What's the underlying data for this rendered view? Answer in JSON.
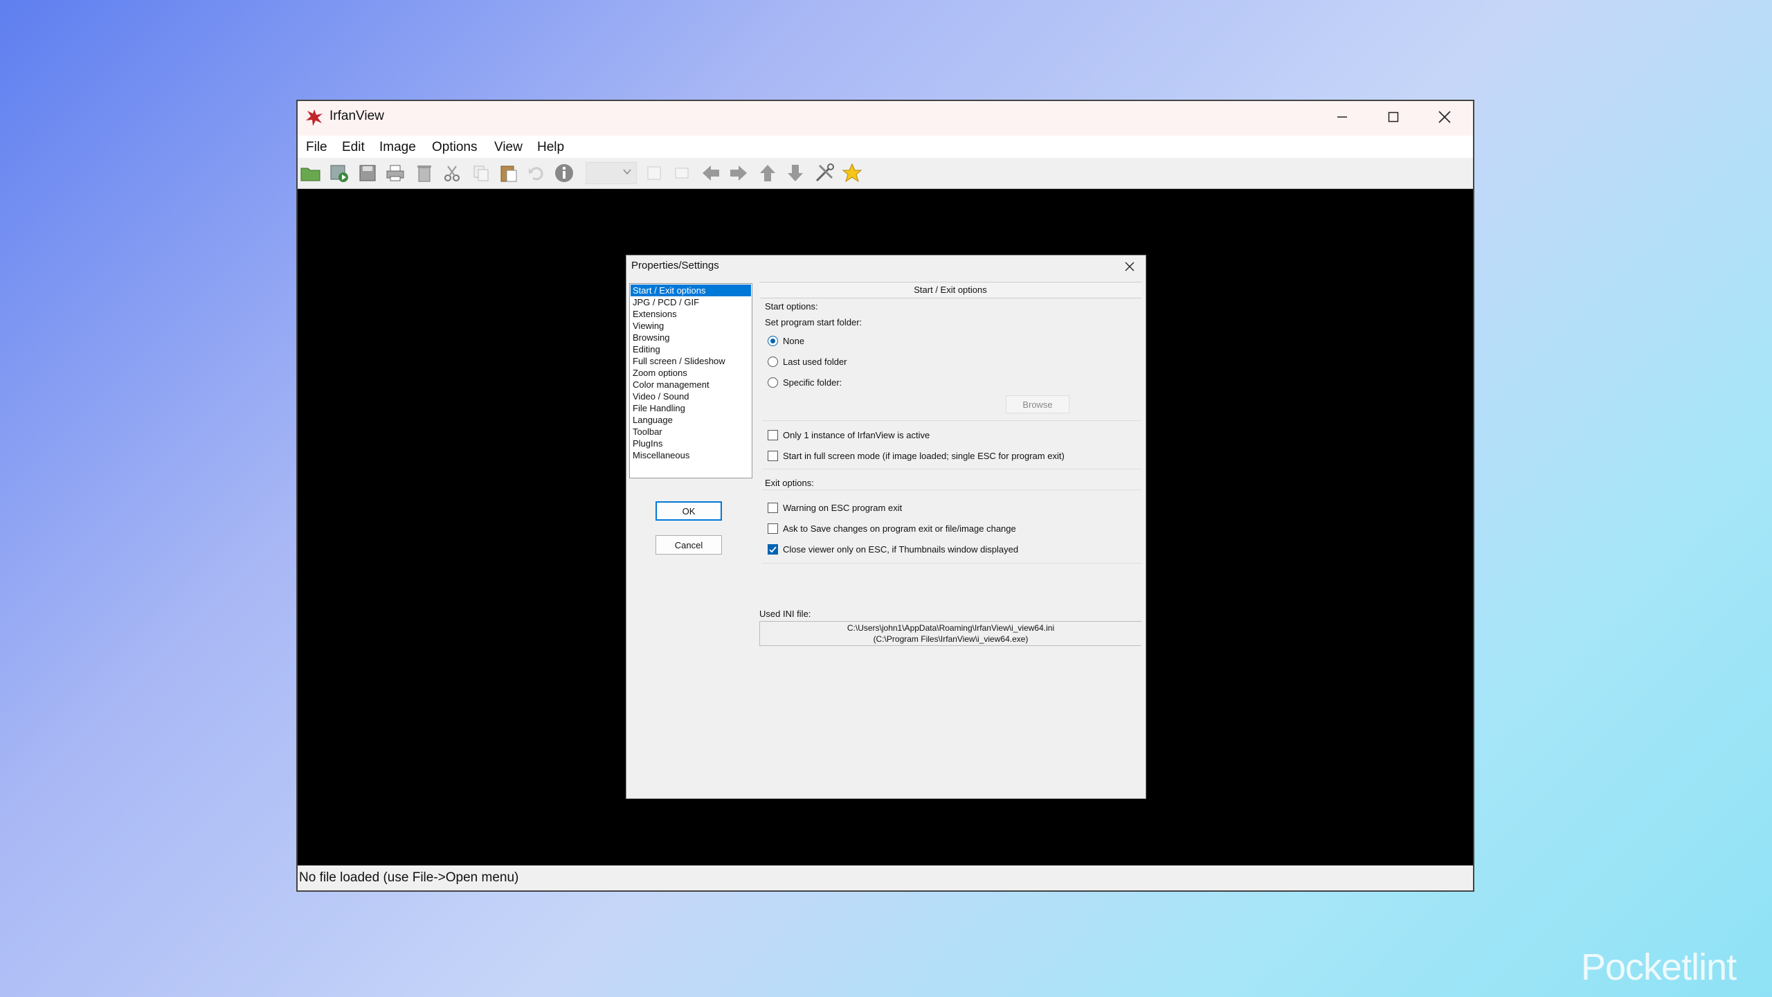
{
  "window": {
    "title": "IrfanView",
    "controls": {
      "minimize": "minimize-icon",
      "maximize": "maximize-icon",
      "close": "close-icon"
    }
  },
  "menu": [
    "File",
    "Edit",
    "Image",
    "Options",
    "View",
    "Help"
  ],
  "toolbar": {
    "icons": [
      "open-folder-icon",
      "slideshow-icon",
      "save-icon",
      "print-icon",
      "delete-icon",
      "cut-icon",
      "copy-icon",
      "paste-icon",
      "undo-icon",
      "info-icon",
      "zoom-combo",
      "fit-icon",
      "fullscreen-icon",
      "prev-icon",
      "next-icon",
      "up-icon",
      "down-icon",
      "settings-icon",
      "favorite-icon"
    ]
  },
  "status": {
    "text": "No file loaded (use File->Open menu)"
  },
  "dialog": {
    "title": "Properties/Settings",
    "categories": [
      "Start / Exit options",
      "JPG / PCD / GIF",
      "Extensions",
      "Viewing",
      "Browsing",
      "Editing",
      "Full screen / Slideshow",
      "Zoom options",
      "Color management",
      "Video / Sound",
      "File Handling",
      "Language",
      "Toolbar",
      "PlugIns",
      "Miscellaneous"
    ],
    "selected_category": "Start / Exit options",
    "ok_label": "OK",
    "cancel_label": "Cancel",
    "panel": {
      "header": "Start / Exit options",
      "start_options_label": "Start options:",
      "start_folder_label": "Set program start folder:",
      "radio_none": "None",
      "radio_last": "Last used folder",
      "radio_specific": "Specific folder:",
      "radio_selected": "None",
      "browse_label": "Browse",
      "check_single_instance": "Only 1 instance of IrfanView is active",
      "check_fullscreen": "Start in full screen mode (if image loaded; single ESC for program exit)",
      "exit_options_label": "Exit options:",
      "check_warn_esc": "Warning on ESC program exit",
      "check_ask_save": "Ask to Save changes on program exit or file/image change",
      "check_close_viewer": "Close viewer only on ESC, if Thumbnails window displayed",
      "checked": {
        "single_instance": false,
        "fullscreen": false,
        "warn_esc": false,
        "ask_save": false,
        "close_viewer": true
      },
      "ini_label": "Used INI file:",
      "ini_line1": "C:\\Users\\john1\\AppData\\Roaming\\IrfanView\\i_view64.ini",
      "ini_line2": "(C:\\Program Files\\IrfanView\\i_view64.exe)"
    }
  },
  "watermark": "Pocketlint",
  "colors": {
    "accent": "#0078d7",
    "titlebar": "#fdf3f3",
    "canvas": "#000000",
    "dialog_bg": "#f0f0f0"
  }
}
